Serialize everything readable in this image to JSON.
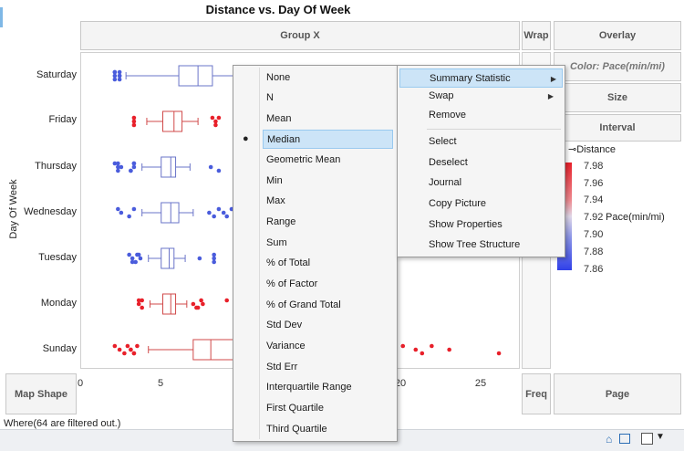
{
  "report": {
    "title": "Distance vs. Day Of Week",
    "y_axis_label": "Day Of Week",
    "categories": [
      "Saturday",
      "Friday",
      "Thursday",
      "Wednesday",
      "Tuesday",
      "Monday",
      "Sunday"
    ],
    "x_ticks": [
      "0",
      "5",
      "20",
      "25"
    ],
    "status_text": "Where(64 are filtered out.)"
  },
  "zones": {
    "group_x": "Group X",
    "wrap": "Wrap",
    "overlay": "Overlay",
    "color": "Color: Pace(min/mi)",
    "size": "Size",
    "interval": "Interval",
    "map_shape": "Map Shape",
    "freq": "Freq",
    "page": "Page"
  },
  "legend": {
    "title": "Distance",
    "color_title": "Pace(min/mi)",
    "ticks": [
      "7.98",
      "7.96",
      "7.94",
      "7.92",
      "7.90",
      "7.88",
      "7.86"
    ],
    "colors": {
      "high": "#e8202a",
      "mid": "#e0d8e8",
      "low": "#3040e8"
    }
  },
  "stat_menu": {
    "items": [
      "None",
      "N",
      "Mean",
      "Median",
      "Geometric Mean",
      "Min",
      "Max",
      "Range",
      "Sum",
      "% of Total",
      "% of Factor",
      "% of Grand Total",
      "Std Dev",
      "Variance",
      "Std Err",
      "Interquartile Range",
      "First Quartile",
      "Third Quartile"
    ],
    "selected": "Median"
  },
  "context_menu": {
    "items": [
      "Summary Statistic",
      "Swap",
      "Remove",
      "Select",
      "Deselect",
      "Journal",
      "Copy Picture",
      "Show Properties",
      "Show Tree Structure"
    ]
  },
  "colors": {
    "red_points": "#e8202a",
    "blue_points": "#4a5cdc",
    "box_red": "#d04a4a",
    "box_blue": "#6a74c8"
  },
  "chart_data": {
    "type": "box",
    "title": "Distance vs. Day Of Week",
    "ylabel": "Day Of Week",
    "xlabel": "",
    "xlim": [
      0,
      27
    ],
    "x_ticks": [
      0,
      5,
      20,
      25
    ],
    "categories": [
      "Saturday",
      "Friday",
      "Thursday",
      "Wednesday",
      "Tuesday",
      "Monday",
      "Sunday"
    ],
    "boxes": [
      {
        "category": "Saturday",
        "whisker_low": 2.8,
        "q1": 6.1,
        "median": 7.3,
        "q3": 8.2,
        "whisker_high": 9.5,
        "color": "blue",
        "outliers": [
          2.1,
          2.1,
          2.1,
          2.1,
          2.4,
          2.4,
          2.4,
          2.4
        ]
      },
      {
        "category": "Friday",
        "whisker_low": 4.1,
        "q1": 5.1,
        "median": 5.8,
        "q3": 6.3,
        "whisker_high": 7.3,
        "color": "red",
        "outliers": [
          3.3,
          3.3,
          3.3,
          8.2,
          8.4,
          8.4,
          8.6
        ]
      },
      {
        "category": "Thursday",
        "whisker_low": 3.8,
        "q1": 5.0,
        "median": 5.6,
        "q3": 5.9,
        "whisker_high": 6.8,
        "color": "blue",
        "outliers": [
          2.1,
          2.3,
          2.3,
          2.3,
          2.5,
          3.1,
          3.3,
          3.3,
          3.1,
          3.3,
          8.1,
          8.6
        ]
      },
      {
        "category": "Wednesday",
        "whisker_low": 3.8,
        "q1": 5.0,
        "median": 5.6,
        "q3": 6.1,
        "whisker_high": 7.0,
        "color": "blue",
        "outliers": [
          2.3,
          2.5,
          3.0,
          3.3,
          8.0,
          8.3,
          8.6,
          8.9,
          9.1,
          9.4,
          9.7,
          9.9
        ]
      },
      {
        "category": "Tuesday",
        "whisker_low": 4.2,
        "q1": 5.0,
        "median": 5.5,
        "q3": 5.8,
        "whisker_high": 6.5,
        "color": "blue",
        "outliers": [
          3.0,
          3.2,
          3.4,
          3.5,
          3.7,
          3.2,
          3.6,
          7.4,
          8.3,
          8.3,
          8.3
        ]
      },
      {
        "category": "Monday",
        "whisker_low": 4.3,
        "q1": 5.1,
        "median": 5.6,
        "q3": 5.9,
        "whisker_high": 6.6,
        "color": "red",
        "outliers": [
          3.6,
          3.6,
          3.8,
          3.8,
          7.0,
          7.2,
          7.5,
          7.6,
          7.3,
          9.1
        ]
      },
      {
        "category": "Sunday",
        "whisker_low": 4.2,
        "q1": 7.0,
        "median": 8.1,
        "q3": 9.5,
        "whisker_high": 10.0,
        "color": "red",
        "outliers": [
          2.1,
          2.4,
          2.7,
          2.9,
          3.1,
          3.3,
          3.5,
          3.1,
          3.3,
          20.1,
          20.9,
          21.3,
          21.9,
          23.0,
          26.1
        ]
      }
    ]
  }
}
